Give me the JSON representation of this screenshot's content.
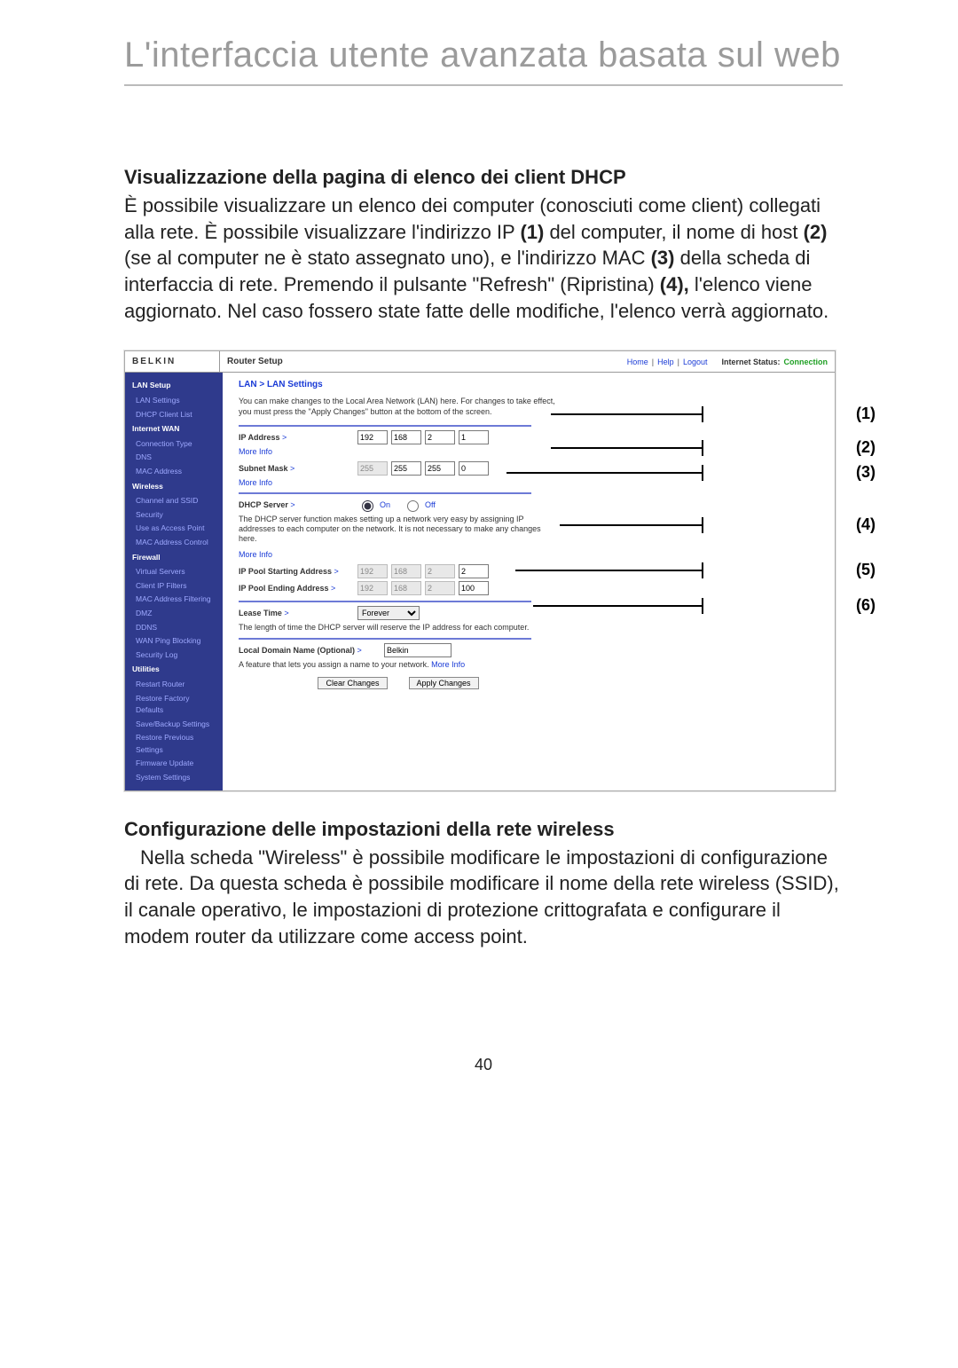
{
  "page": {
    "title": "L'interfaccia utente avanzata basata sul web",
    "number": "40"
  },
  "sections": {
    "dhcp": {
      "heading": "Visualizzazione della pagina di elenco dei client DHCP",
      "para_html": "È possibile visualizzare un elenco dei computer (conosciuti come client) collegati alla rete. È possibile visualizzare l'indirizzo IP <b>(1)</b> del computer, il nome di host <b>(2)</b> (se al computer ne è stato assegnato uno), e l'indirizzo MAC <b>(3)</b> della scheda di interfaccia di rete. Premendo il pulsante \"Refresh\" (Ripristina) <b>(4),</b> l'elenco viene aggiornato. Nel caso fossero state fatte delle modifiche, l'elenco verrà aggiornato."
    },
    "wireless": {
      "heading": "Configurazione delle impostazioni della rete wireless",
      "para": "Nella scheda \"Wireless\" è possibile modificare le impostazioni di configurazione di rete. Da questa scheda è possibile modificare il nome della rete wireless (SSID), il canale operativo, le impostazioni di protezione crittografata e configurare il modem router da utilizzare come access point."
    }
  },
  "shot": {
    "logo": "BELKIN",
    "title": "Router Setup",
    "nav": {
      "home": "Home",
      "help": "Help",
      "logout": "Logout",
      "status_label": "Internet Status:",
      "status_value": "Connection"
    },
    "sidebar": {
      "groups": [
        {
          "cat": "LAN Setup",
          "items": [
            "LAN Settings",
            "DHCP Client List"
          ]
        },
        {
          "cat": "Internet WAN",
          "items": [
            "Connection Type",
            "DNS",
            "MAC Address"
          ]
        },
        {
          "cat": "Wireless",
          "items": [
            "Channel and SSID",
            "Security",
            "Use as Access Point",
            "MAC Address Control"
          ]
        },
        {
          "cat": "Firewall",
          "items": [
            "Virtual Servers",
            "Client IP Filters",
            "MAC Address Filtering",
            "DMZ",
            "DDNS",
            "WAN Ping Blocking",
            "Security Log"
          ]
        },
        {
          "cat": "Utilities",
          "items": [
            "Restart Router",
            "Restore Factory Defaults",
            "Save/Backup Settings",
            "Restore Previous Settings",
            "Firmware Update",
            "System Settings"
          ]
        }
      ]
    },
    "pane": {
      "breadcrumb": "LAN > LAN Settings",
      "intro": "You can make changes to the Local Area Network (LAN) here. For changes to take effect, you must press the \"Apply Changes\" button at the bottom of the screen.",
      "ip_label": "IP Address",
      "ip": [
        "192",
        "168",
        "2",
        "1"
      ],
      "more": "More Info",
      "mask_label": "Subnet Mask",
      "mask": [
        "255",
        "255",
        "255",
        "0"
      ],
      "dhcp_label": "DHCP Server",
      "on": "On",
      "off": "Off",
      "dhcp_desc": "The DHCP server function makes setting up a network very easy by assigning IP addresses to each computer on the network. It is not necessary to make any changes here.",
      "pool_start": "IP Pool Starting Address",
      "pool_start_v": [
        "192",
        "168",
        "2",
        "2"
      ],
      "pool_end": "IP Pool Ending Address",
      "pool_end_v": [
        "192",
        "168",
        "2",
        "100"
      ],
      "lease_label": "Lease Time",
      "lease_value": "Forever",
      "lease_desc": "The length of time the DHCP server will reserve the IP address for each computer.",
      "domain_label": "Local Domain Name (Optional)",
      "domain_value": "Belkin",
      "domain_desc": "A feature that lets you assign a name to your network.",
      "clear": "Clear Changes",
      "apply": "Apply Changes"
    }
  },
  "callouts": {
    "c1": "(1)",
    "c2": "(2)",
    "c3": "(3)",
    "c4": "(4)",
    "c5": "(5)",
    "c6": "(6)"
  }
}
